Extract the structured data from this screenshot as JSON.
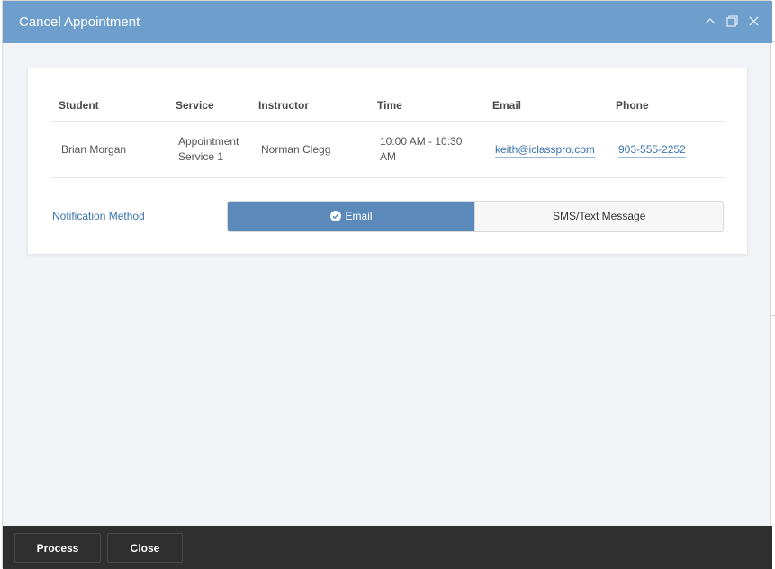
{
  "modal": {
    "title": "Cancel Appointment"
  },
  "table": {
    "headers": [
      "Student",
      "Service",
      "Instructor",
      "Time",
      "Email",
      "Phone"
    ],
    "row": {
      "student": "Brian Morgan",
      "service": "Appointment Service 1",
      "instructor": "Norman Clegg",
      "time": "10:00 AM - 10:30 AM",
      "email": "keith@iclasspro.com",
      "phone": "903-555-2252"
    }
  },
  "notification": {
    "label": "Notification Method",
    "options": [
      "Email",
      "SMS/Text Message"
    ],
    "selected": "Email"
  },
  "footer": {
    "process_label": "Process",
    "close_label": "Close"
  },
  "colors": {
    "header": "#6e9fcc",
    "active_option": "#5a89ba",
    "footer": "#2f2f30",
    "link": "#3b73b0"
  },
  "icons": [
    "chevron-up-icon",
    "maximize-icon",
    "close-icon",
    "check-circle-icon"
  ]
}
